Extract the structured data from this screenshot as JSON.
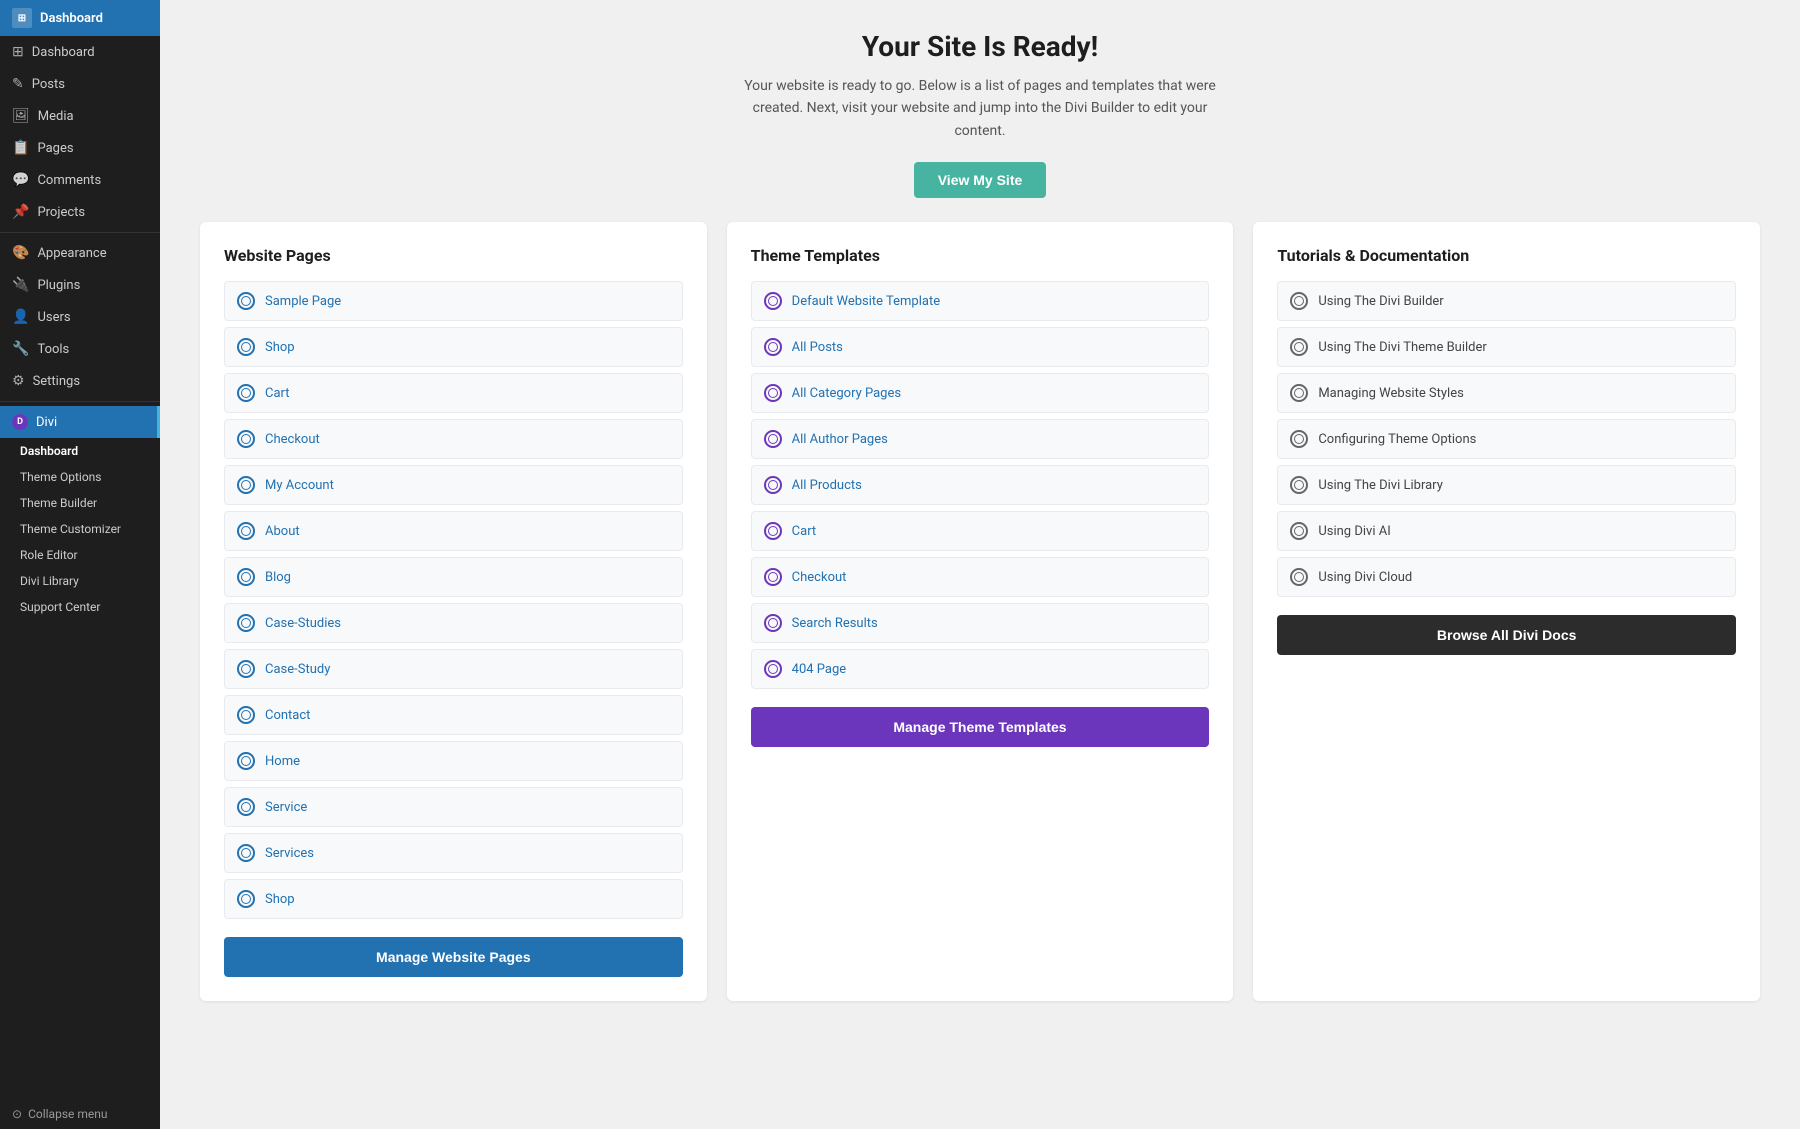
{
  "sidebar": {
    "logo": "Dashboard",
    "nav_items": [
      {
        "label": "Dashboard",
        "icon": "⊞",
        "active": false
      },
      {
        "label": "Posts",
        "icon": "📄",
        "active": false
      },
      {
        "label": "Media",
        "icon": "🖼",
        "active": false
      },
      {
        "label": "Pages",
        "icon": "📋",
        "active": false
      },
      {
        "label": "Comments",
        "icon": "💬",
        "active": false
      },
      {
        "label": "Projects",
        "icon": "📌",
        "active": false
      },
      {
        "label": "Appearance",
        "icon": "🎨",
        "active": false
      },
      {
        "label": "Plugins",
        "icon": "🔌",
        "active": false
      },
      {
        "label": "Users",
        "icon": "👤",
        "active": false
      },
      {
        "label": "Tools",
        "icon": "🔧",
        "active": false
      },
      {
        "label": "Settings",
        "icon": "⚙",
        "active": false
      }
    ],
    "divi_label": "Divi",
    "divi_sub_items": [
      {
        "label": "Dashboard",
        "active": true
      },
      {
        "label": "Theme Options",
        "active": false
      },
      {
        "label": "Theme Builder",
        "active": false
      },
      {
        "label": "Theme Customizer",
        "active": false
      },
      {
        "label": "Role Editor",
        "active": false
      },
      {
        "label": "Divi Library",
        "active": false
      },
      {
        "label": "Support Center",
        "active": false
      }
    ],
    "collapse_label": "Collapse menu"
  },
  "header": {
    "title": "Your Site Is Ready!",
    "description": "Your website is ready to go. Below is a list of pages and templates that were created. Next, visit your website and jump into the Divi Builder to edit your content.",
    "view_site_btn": "View My Site"
  },
  "website_pages": {
    "title": "Website Pages",
    "items": [
      "Sample Page",
      "Shop",
      "Cart",
      "Checkout",
      "My Account",
      "About",
      "Blog",
      "Case-Studies",
      "Case-Study",
      "Contact",
      "Home",
      "Service",
      "Services",
      "Shop"
    ],
    "manage_btn": "Manage Website Pages"
  },
  "theme_templates": {
    "title": "Theme Templates",
    "items": [
      "Default Website Template",
      "All Posts",
      "All Category Pages",
      "All Author Pages",
      "All Products",
      "Cart",
      "Checkout",
      "Search Results",
      "404 Page"
    ],
    "manage_btn": "Manage Theme Templates"
  },
  "tutorials": {
    "title": "Tutorials & Documentation",
    "items": [
      "Using The Divi Builder",
      "Using The Divi Theme Builder",
      "Managing Website Styles",
      "Configuring Theme Options",
      "Using The Divi Library",
      "Using Divi AI",
      "Using Divi Cloud"
    ],
    "browse_btn": "Browse All Divi Docs"
  }
}
